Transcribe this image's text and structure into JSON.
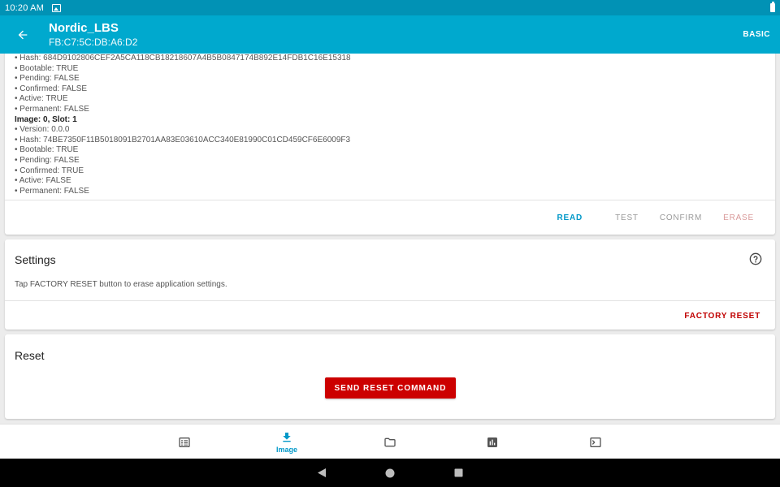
{
  "status_bar": {
    "time": "10:20 AM",
    "icons": [
      "image-icon",
      "battery-icon"
    ]
  },
  "app_bar": {
    "title": "Nordic_LBS",
    "subtitle": "FB:C7:5C:DB:A6:D2",
    "mode_label": "BASIC"
  },
  "images": {
    "lines": [
      {
        "text": "• Hash: 684D9102806CEF2A5CA118CB18218607A4B5B0847174B892E14FDB1C16E15318",
        "bold": false
      },
      {
        "text": "• Bootable: TRUE",
        "bold": false
      },
      {
        "text": "• Pending: FALSE",
        "bold": false
      },
      {
        "text": "• Confirmed: FALSE",
        "bold": false
      },
      {
        "text": "• Active: TRUE",
        "bold": false
      },
      {
        "text": "• Permanent: FALSE",
        "bold": false
      },
      {
        "text": "Image: 0, Slot: 1",
        "bold": true
      },
      {
        "text": "• Version: 0.0.0",
        "bold": false
      },
      {
        "text": "• Hash: 74BE7350F11B5018091B2701AA83E03610ACC340E81990C01CD459CF6E6009F3",
        "bold": false
      },
      {
        "text": "• Bootable: TRUE",
        "bold": false
      },
      {
        "text": "• Pending: FALSE",
        "bold": false
      },
      {
        "text": "• Confirmed: TRUE",
        "bold": false
      },
      {
        "text": "• Active: FALSE",
        "bold": false
      },
      {
        "text": "• Permanent: FALSE",
        "bold": false
      }
    ],
    "actions": {
      "read": "READ",
      "test": "TEST",
      "confirm": "CONFIRM",
      "erase": "ERASE"
    }
  },
  "settings": {
    "title": "Settings",
    "description": "Tap FACTORY RESET button to erase application settings.",
    "factory_reset_label": "FACTORY RESET"
  },
  "reset": {
    "title": "Reset",
    "button_label": "SEND RESET COMMAND"
  },
  "bottom_nav": {
    "image_label": "Image",
    "active_color": "#0198c8",
    "inactive_color": "#555555"
  },
  "colors": {
    "primary": "#00a9ce",
    "status_bar": "#0192b5",
    "danger": "#cc0000"
  }
}
